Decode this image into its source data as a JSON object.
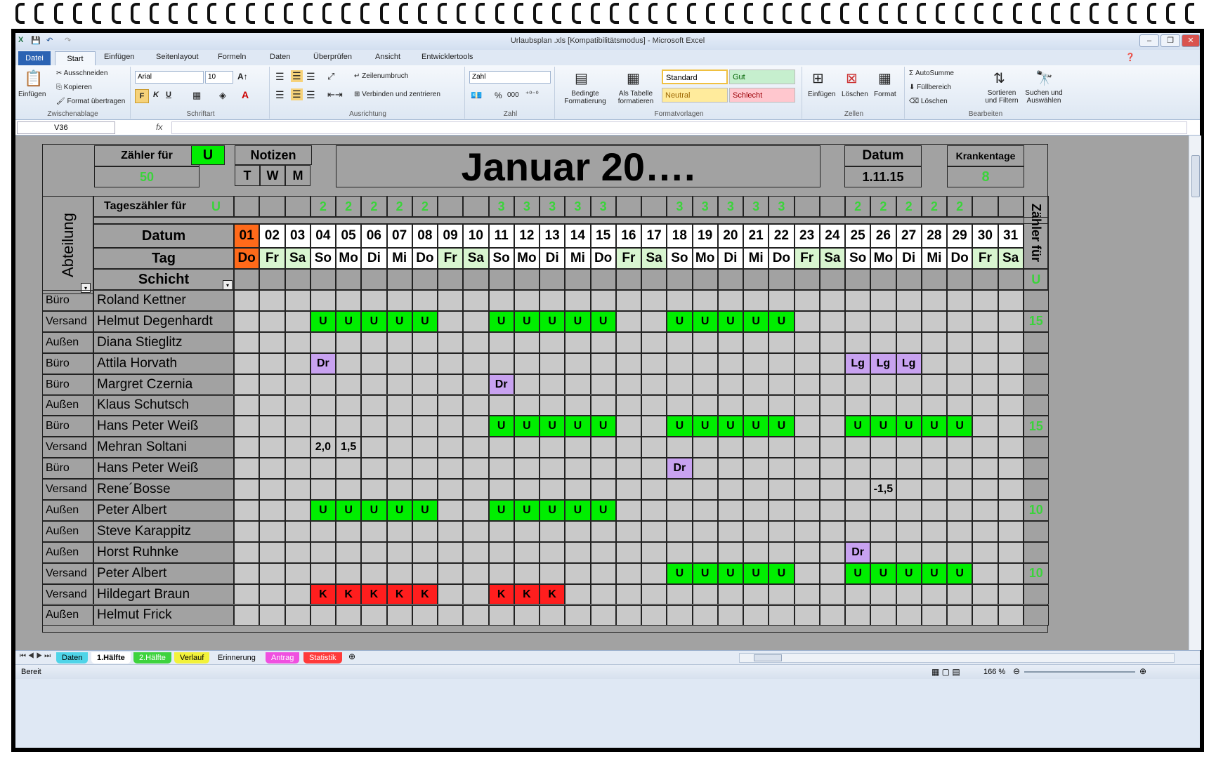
{
  "window": {
    "title": "Urlaubsplan .xls  [Kompatibilitätsmodus]  -  Microsoft Excel",
    "file_tab": "Datei",
    "tabs": [
      "Start",
      "Einfügen",
      "Seitenlayout",
      "Formeln",
      "Daten",
      "Überprüfen",
      "Ansicht",
      "Entwicklertools"
    ]
  },
  "ribbon": {
    "clipboard": {
      "paste": "Einfügen",
      "cut": "Ausschneiden",
      "copy": "Kopieren",
      "format_painter": "Format übertragen",
      "label": "Zwischenablage"
    },
    "font": {
      "name": "Arial",
      "size": "10",
      "label": "Schriftart",
      "bold": "F",
      "italic": "K",
      "underline": "U"
    },
    "alignment": {
      "wrap": "Zeilenumbruch",
      "merge": "Verbinden und zentrieren",
      "label": "Ausrichtung"
    },
    "number": {
      "format": "Zahl",
      "percent": "%",
      "thousands": "000",
      "label": "Zahl"
    },
    "styles": {
      "conditional": "Bedingte Formatierung",
      "as_table": "Als Tabelle formatieren",
      "standard": "Standard",
      "gut": "Gut",
      "neutral": "Neutral",
      "schlecht": "Schlecht",
      "label": "Formatvorlagen"
    },
    "cells": {
      "insert": "Einfügen",
      "delete": "Löschen",
      "format": "Format",
      "label": "Zellen"
    },
    "editing": {
      "autosum": "AutoSumme",
      "fill": "Füllbereich",
      "clear": "Löschen",
      "sort": "Sortieren und Filtern",
      "find": "Suchen und Auswählen",
      "label": "Bearbeiten"
    }
  },
  "formula_bar": {
    "name_box": "V36",
    "fx": "fx",
    "value": ""
  },
  "planner": {
    "counter_label": "Zähler für",
    "counter_code": "U",
    "counter_value": "50",
    "notes_label": "Notizen",
    "notes_cols": [
      "T",
      "W",
      "M"
    ],
    "month_title": "Januar 20….",
    "date_label": "Datum",
    "date_value": "1.11.15",
    "sick_label": "Krankentage",
    "sick_value": "8",
    "dept_label": "Abteilung",
    "daily_counter_label": "Tageszähler für",
    "daily_counter_code": "U",
    "row_date_label": "Datum",
    "row_day_label": "Tag",
    "row_shift_label": "Schicht",
    "right_counter_label": "Zähler für",
    "right_counter_code": "U",
    "day_numbers": [
      "01",
      "02",
      "03",
      "04",
      "05",
      "06",
      "07",
      "08",
      "09",
      "10",
      "11",
      "12",
      "13",
      "14",
      "15",
      "16",
      "17",
      "18",
      "19",
      "20",
      "21",
      "22",
      "23",
      "24",
      "25",
      "26",
      "27",
      "28",
      "29",
      "30",
      "31"
    ],
    "weekdays": [
      "Do",
      "Fr",
      "Sa",
      "So",
      "Mo",
      "Di",
      "Mi",
      "Do",
      "Fr",
      "Sa",
      "So",
      "Mo",
      "Di",
      "Mi",
      "Do",
      "Fr",
      "Sa",
      "So",
      "Mo",
      "Di",
      "Mi",
      "Do",
      "Fr",
      "Sa",
      "So",
      "Mo",
      "Di",
      "Mi",
      "Do",
      "Fr",
      "Sa"
    ],
    "daily_counts": [
      "",
      "",
      "",
      "2",
      "2",
      "2",
      "2",
      "2",
      "",
      "",
      "3",
      "3",
      "3",
      "3",
      "3",
      "",
      "",
      "3",
      "3",
      "3",
      "3",
      "3",
      "",
      "",
      "2",
      "2",
      "2",
      "2",
      "2",
      "",
      ""
    ],
    "employees": [
      {
        "dept": "Büro",
        "name": "Roland Kettner",
        "total": "",
        "entries": {}
      },
      {
        "dept": "Versand",
        "name": "Helmut Degenhardt",
        "total": "15",
        "entries": {
          "4": "U",
          "5": "U",
          "6": "U",
          "7": "U",
          "8": "U",
          "11": "U",
          "12": "U",
          "13": "U",
          "14": "U",
          "15": "U",
          "18": "U",
          "19": "U",
          "20": "U",
          "21": "U",
          "22": "U"
        }
      },
      {
        "dept": "Außen",
        "name": "Diana Stieglitz",
        "total": "",
        "entries": {}
      },
      {
        "dept": "Büro",
        "name": "Attila Horvath",
        "total": "",
        "entries": {
          "4": "Dr",
          "25": "Lg",
          "26": "Lg",
          "27": "Lg"
        }
      },
      {
        "dept": "Büro",
        "name": "Margret Czernia",
        "total": "",
        "entries": {
          "11": "Dr"
        }
      },
      {
        "dept": "Außen",
        "name": "Klaus Schutsch",
        "total": "",
        "entries": {}
      },
      {
        "dept": "Büro",
        "name": "Hans Peter Weiß",
        "total": "15",
        "entries": {
          "11": "U",
          "12": "U",
          "13": "U",
          "14": "U",
          "15": "U",
          "18": "U",
          "19": "U",
          "20": "U",
          "21": "U",
          "22": "U",
          "25": "U",
          "26": "U",
          "27": "U",
          "28": "U",
          "29": "U"
        }
      },
      {
        "dept": "Versand",
        "name": "Mehran Soltani",
        "total": "",
        "entries": {
          "4": "2,0",
          "5": "1,5"
        }
      },
      {
        "dept": "Büro",
        "name": "Hans Peter Weiß",
        "total": "",
        "entries": {
          "18": "Dr"
        }
      },
      {
        "dept": "Versand",
        "name": "Rene´Bosse",
        "total": "",
        "entries": {
          "26": "-1,5"
        }
      },
      {
        "dept": "Außen",
        "name": "Peter Albert",
        "total": "10",
        "entries": {
          "4": "U",
          "5": "U",
          "6": "U",
          "7": "U",
          "8": "U",
          "11": "U",
          "12": "U",
          "13": "U",
          "14": "U",
          "15": "U"
        }
      },
      {
        "dept": "Außen",
        "name": "Steve Karappitz",
        "total": "",
        "entries": {}
      },
      {
        "dept": "Außen",
        "name": "Horst Ruhnke",
        "total": "",
        "entries": {
          "25": "Dr"
        }
      },
      {
        "dept": "Versand",
        "name": "Peter Albert",
        "total": "10",
        "entries": {
          "18": "U",
          "19": "U",
          "20": "U",
          "21": "U",
          "22": "U",
          "25": "U",
          "26": "U",
          "27": "U",
          "28": "U",
          "29": "U"
        }
      },
      {
        "dept": "Versand",
        "name": "Hildegart Braun",
        "total": "",
        "entries": {
          "4": "K",
          "5": "K",
          "6": "K",
          "7": "K",
          "8": "K",
          "11": "K",
          "12": "K",
          "13": "K"
        }
      },
      {
        "dept": "Außen",
        "name": "Helmut Frick",
        "total": "",
        "entries": {}
      }
    ]
  },
  "sheet_tabs": [
    "Daten",
    "1.Hälfte",
    "2.Hälfte",
    "Verlauf",
    "Erinnerung",
    "Antrag",
    "Statistik"
  ],
  "status": {
    "ready": "Bereit",
    "zoom": "166 %"
  },
  "colors": {
    "vacation": "#00ee00",
    "doctor": "#c8a2f0",
    "sick": "#ff1e1e",
    "weekend": "#d8f5d0",
    "today": "#ff6a1a",
    "counter_text": "#3bd33b",
    "grid": "#c9c9c9",
    "label_gray": "#a2a2a2"
  }
}
